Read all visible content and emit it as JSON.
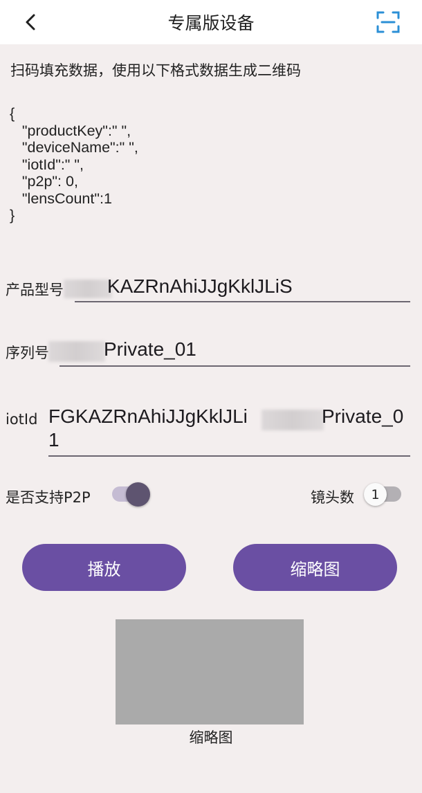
{
  "header": {
    "title": "专属版设备",
    "back_icon": "chevron-left-icon",
    "scan_icon": "scan-icon",
    "accent": "#2b8fd6"
  },
  "hint": "扫码填充数据，使用以下格式数据生成二维码",
  "json_example": "{\n   \"productKey\":\" \",\n   \"deviceName\":\" \",\n   \"iotId\":\" \",\n   \"p2p\": 0,\n   \"lensCount\":1\n}",
  "fields": {
    "product": {
      "label": "产品型号",
      "value": "KAZRnAhiJJgKklJLiS"
    },
    "serial": {
      "label": "序列号",
      "value": "Private_01"
    },
    "iotid": {
      "label": "iotId",
      "value_line1": "FGKAZRnAhiJJgKklJLi",
      "value_line1b": "Private_0",
      "value_line2": "1"
    }
  },
  "toggles": {
    "p2p": {
      "label": "是否支持P2P",
      "on": true
    },
    "lens": {
      "label": "镜头数",
      "value": "1",
      "on": false
    }
  },
  "buttons": {
    "play": "播放",
    "thumbnail": "缩略图"
  },
  "thumbnail_caption": "缩略图",
  "colors": {
    "primary": "#6a4fa3",
    "background": "#f3eeee",
    "thumb_placeholder": "#aaaaaa"
  }
}
